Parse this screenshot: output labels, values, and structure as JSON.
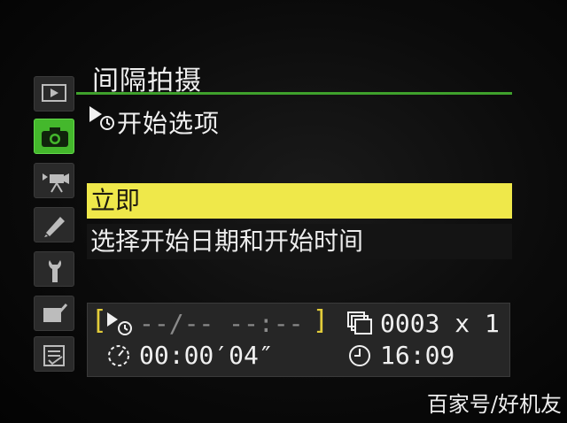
{
  "menu": {
    "title": "间隔拍摄",
    "subtitle": "开始选项",
    "options": [
      {
        "label": "立即",
        "selected": true
      },
      {
        "label": "选择开始日期和开始时间",
        "selected": false
      }
    ]
  },
  "sidebar": {
    "tabs": [
      {
        "icon": "playback-icon"
      },
      {
        "icon": "camera-icon",
        "active": true
      },
      {
        "icon": "movie-icon"
      },
      {
        "icon": "pencil-icon"
      },
      {
        "icon": "wrench-icon"
      },
      {
        "icon": "retouch-icon"
      },
      {
        "icon": "my-menu-icon"
      }
    ]
  },
  "status": {
    "start_time": "--/--  --:--",
    "interval": "00:00′04″",
    "shots": "0003 x 1",
    "clock": "16:09"
  },
  "watermark": "百家号/好机友",
  "colors": {
    "accent_green": "#44b82c",
    "highlight_yellow": "#efe84a",
    "bracket_yellow": "#e2cc3a"
  }
}
